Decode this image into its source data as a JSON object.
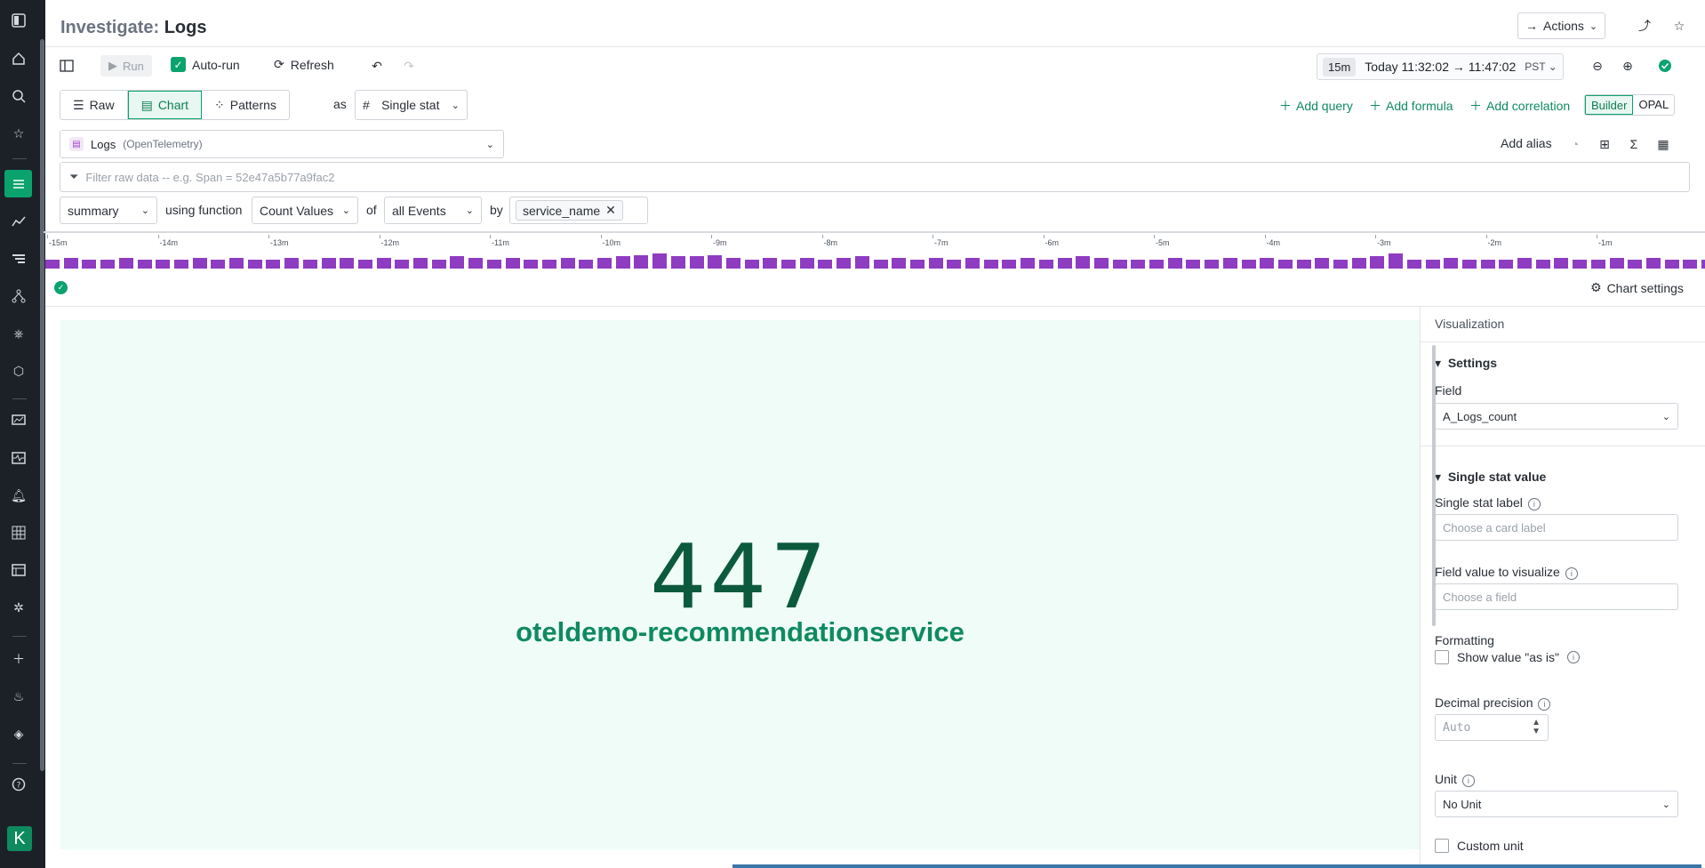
{
  "title": {
    "prefix": "Investigate:",
    "name": "Logs"
  },
  "header_actions": {
    "actions_label": "Actions"
  },
  "toolbar": {
    "run_label": "Run",
    "autorun_label": "Auto-run",
    "refresh_label": "Refresh",
    "time_preset": "15m",
    "time_range": "Today 11:32:02 → 11:47:02",
    "timezone": "PST"
  },
  "modes": {
    "tabs": [
      "Raw",
      "Chart",
      "Patterns"
    ],
    "active": "Chart",
    "as_label": "as",
    "viz_type": "Single stat",
    "add_query": "Add query",
    "add_formula": "Add formula",
    "add_correlation": "Add correlation",
    "builder": "Builder",
    "opal": "OPAL"
  },
  "source": {
    "name": "Logs",
    "sub": "(OpenTelemetry)"
  },
  "add_alias": "Add alias",
  "filter": {
    "placeholder": "Filter raw data -- e.g. Span = 52e47a5b77a9fac2"
  },
  "function_row": {
    "summary": "summary",
    "using_label": "using function",
    "function": "Count Values",
    "of_label": "of",
    "events": "all Events",
    "by_label": "by",
    "group_tag": "service_name"
  },
  "histogram": {
    "ticks": [
      "-15m",
      "-14m",
      "-13m",
      "-12m",
      "-11m",
      "-10m",
      "-9m",
      "-8m",
      "-7m",
      "-6m",
      "-5m",
      "-4m",
      "-3m",
      "-2m",
      "-1m"
    ],
    "bar_levels": [
      0.6,
      0.7,
      0.6,
      0.6,
      0.7,
      0.6,
      0.6,
      0.6,
      0.7,
      0.6,
      0.7,
      0.6,
      0.6,
      0.7,
      0.6,
      0.7,
      0.7,
      0.6,
      0.7,
      0.6,
      0.7,
      0.6,
      0.8,
      0.7,
      0.6,
      0.7,
      0.6,
      0.6,
      0.7,
      0.6,
      0.7,
      0.8,
      0.9,
      1.0,
      0.8,
      0.8,
      0.9,
      0.7,
      0.6,
      0.7,
      0.6,
      0.7,
      0.6,
      0.7,
      0.8,
      0.6,
      0.7,
      0.6,
      0.7,
      0.6,
      0.7,
      0.6,
      0.6,
      0.7,
      0.6,
      0.7,
      0.8,
      0.7,
      0.6,
      0.6,
      0.6,
      0.7,
      0.6,
      0.6,
      0.7,
      0.6,
      0.7,
      0.6,
      0.6,
      0.7,
      0.6,
      0.7,
      0.8,
      1.0,
      0.6,
      0.6,
      0.7,
      0.6,
      0.6,
      0.6,
      0.7,
      0.6,
      0.7,
      0.6,
      0.6,
      0.7,
      0.6,
      0.7,
      0.6,
      0.6,
      0.6,
      0.6,
      0.3
    ]
  },
  "chart_settings_label": "Chart settings",
  "stat": {
    "value": "447",
    "label": "oteldemo-recommendationservice"
  },
  "panel": {
    "header": "Visualization",
    "settings_title": "Settings",
    "field_label": "Field",
    "field_value": "A_Logs_count",
    "single_stat_title": "Single stat value",
    "stat_label_title": "Single stat label",
    "stat_label_placeholder": "Choose a card label",
    "field_visualize_title": "Field value to visualize",
    "field_visualize_placeholder": "Choose a field",
    "formatting_title": "Formatting",
    "show_as_is": "Show value \"as is\"",
    "decimal_title": "Decimal precision",
    "decimal_placeholder": "Auto",
    "unit_title": "Unit",
    "unit_value": "No Unit",
    "custom_unit": "Custom unit"
  },
  "colors": {
    "accent": "#0aa36e",
    "histogram": "#8e3cc1",
    "stat_bg": "#effcf7",
    "stat_value": "#0c5a3e",
    "nav_bg": "#1c2128"
  }
}
